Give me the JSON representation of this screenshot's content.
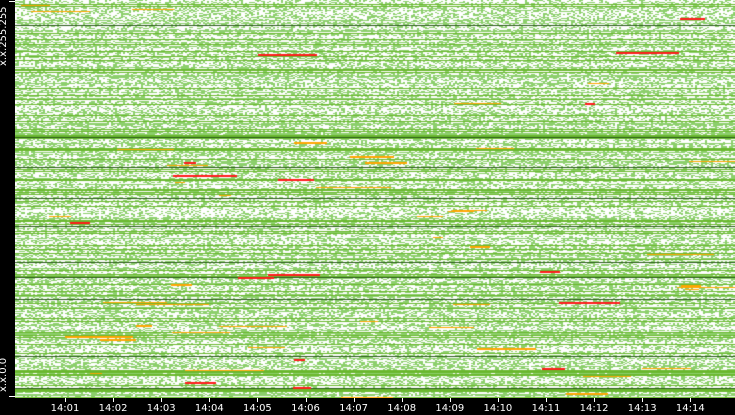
{
  "chart_data": {
    "type": "heatmap",
    "title": "",
    "xlabel": "",
    "ylabel": "",
    "x_tick_labels": [
      "14:01",
      "14:02",
      "14:03",
      "14:04",
      "14:05",
      "14:06",
      "14:07",
      "14:08",
      "14:09",
      "14:10",
      "14:11",
      "14:12",
      "14:13",
      "14:14"
    ],
    "y_tick_labels": [
      "x.x.255.255",
      "x.x.0.0"
    ],
    "y_range": [
      "x.x.0.0",
      "x.x.255.255"
    ],
    "colors": {
      "low": "#8ccf6c",
      "mid": "#6ab82e",
      "high": "#ffa500",
      "peak": "#ff1a1a",
      "dark": "#2a5a1a",
      "background": "#ffffff"
    }
  }
}
